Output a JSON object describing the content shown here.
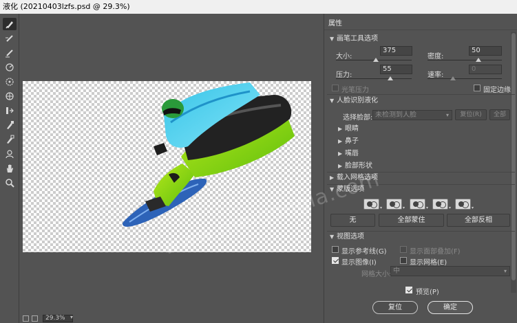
{
  "window": {
    "title": "液化 (20210403lzfs.psd @ 29.3%)"
  },
  "tools": [
    {
      "name": "forward-warp-tool",
      "icon": "finger-brush-icon"
    },
    {
      "name": "reconstruct-tool",
      "icon": "reconstruct-brush-icon"
    },
    {
      "name": "smooth-tool",
      "icon": "smooth-brush-icon"
    },
    {
      "name": "twirl-tool",
      "icon": "twirl-icon"
    },
    {
      "name": "pucker-tool",
      "icon": "pucker-icon"
    },
    {
      "name": "bloat-tool",
      "icon": "bloat-icon"
    },
    {
      "name": "push-left-tool",
      "icon": "push-left-icon"
    },
    {
      "name": "freeze-mask-tool",
      "icon": "freeze-mask-icon"
    },
    {
      "name": "thaw-mask-tool",
      "icon": "thaw-mask-icon"
    },
    {
      "name": "face-tool",
      "icon": "face-icon"
    },
    {
      "name": "hand-tool",
      "icon": "hand-icon"
    },
    {
      "name": "zoom-tool",
      "icon": "zoom-icon"
    }
  ],
  "status": {
    "zoom": "29.3%"
  },
  "panel": {
    "title": "属性",
    "brush": {
      "header": "画笔工具选项",
      "size_label": "大小:",
      "size_value": "375",
      "density_label": "密度:",
      "density_value": "50",
      "pressure_label": "压力:",
      "pressure_value": "55",
      "rate_label": "速率:",
      "rate_value": "0",
      "stylus_label": "光笔压力",
      "pin_edges_label": "固定边缘"
    },
    "face": {
      "header": "人脸识别液化",
      "select_label": "选择脸部:",
      "select_value": "未检测到人脸",
      "reset_label": "复位(R)",
      "all_label": "全部",
      "subsections": [
        "眼睛",
        "鼻子",
        "嘴唇",
        "脸部形状"
      ]
    },
    "mesh": {
      "header": "载入网格选项"
    },
    "mask": {
      "header": "蒙版选项",
      "none_label": "无",
      "mask_all_label": "全部蒙住",
      "invert_all_label": "全部反相"
    },
    "view": {
      "header": "视图选项",
      "show_guides_label": "显示参考线(G)",
      "show_face_overlay_label": "显示面部叠加(F)",
      "show_image_label": "显示图像(I)",
      "show_mesh_label": "显示网格(E)",
      "mesh_size_label": "网格大小:",
      "mesh_size_value": "中"
    },
    "preview_label": "预览(P)",
    "reset_button": "复位",
    "ok_button": "确定"
  },
  "watermark": "www.meigongla.com",
  "colors": {
    "bg": "#535353",
    "panel": "#535353",
    "input": "#454545"
  }
}
